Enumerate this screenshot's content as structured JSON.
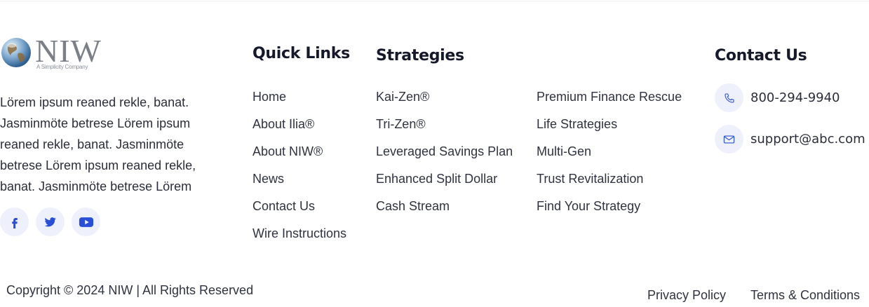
{
  "brand": {
    "logo_text": "NIW",
    "tagline": "A Simplicity Company",
    "description": "Lörem ipsum reaned rekle, banat. Jasminmöte betrese  Lörem ipsum reaned rekle, banat. Jasminmöte betrese Lörem ipsum reaned rekle, banat. Jasminmöte betrese Lörem",
    "socials": [
      "facebook-icon",
      "twitter-icon",
      "youtube-icon"
    ]
  },
  "quick_links": {
    "heading": "Quick Links",
    "items": [
      "Home",
      "About Ilia®",
      "About NIW®",
      "News",
      "Contact Us",
      "Wire Instructions"
    ]
  },
  "strategies": {
    "heading": "Strategies",
    "column1": [
      "Kai-Zen®",
      "Tri-Zen®",
      "Leveraged Savings Plan",
      "Enhanced Split Dollar",
      "Cash Stream"
    ],
    "column2": [
      "Premium Finance Rescue",
      "Life Strategies",
      "Multi-Gen",
      "Trust Revitalization",
      "Find Your Strategy"
    ]
  },
  "contact": {
    "heading": "Contact Us",
    "phone": "800-294-9940",
    "email": "support@abc.com"
  },
  "footer": {
    "copyright": "Copyright © 2024 NIW | All Rights Reserved",
    "privacy": "Privacy Policy",
    "terms": "Terms & Conditions"
  },
  "colors": {
    "accent": "#2a4fd6",
    "icon_bg": "#eef1fb",
    "heading": "#15192a",
    "text": "#2f3240"
  }
}
